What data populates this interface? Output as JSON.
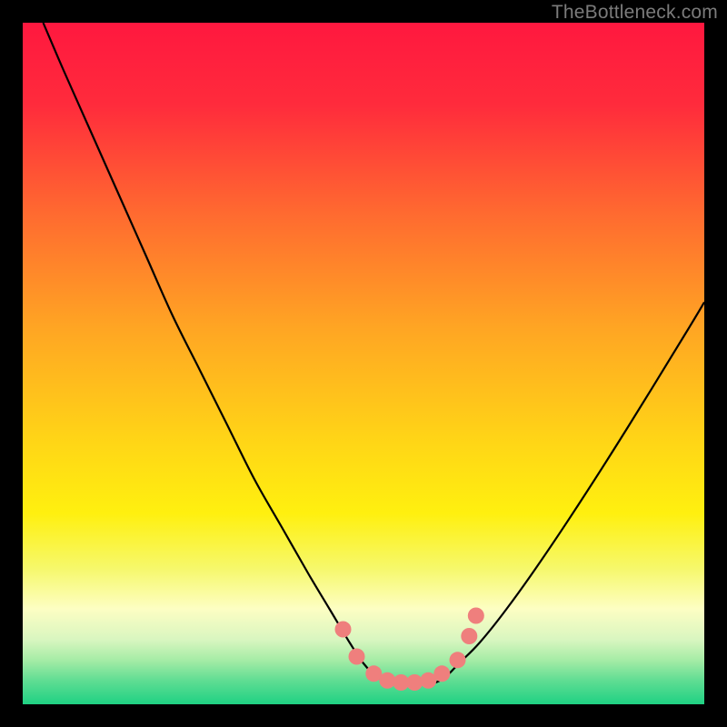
{
  "watermark": "TheBottleneck.com",
  "chart_data": {
    "type": "line",
    "title": "",
    "xlabel": "",
    "ylabel": "",
    "xlim": [
      0,
      100
    ],
    "ylim": [
      0,
      100
    ],
    "background_gradient": {
      "stops": [
        {
          "pos": 0.0,
          "color": "#ff183f"
        },
        {
          "pos": 0.12,
          "color": "#ff2b3c"
        },
        {
          "pos": 0.28,
          "color": "#ff6a30"
        },
        {
          "pos": 0.45,
          "color": "#ffa623"
        },
        {
          "pos": 0.62,
          "color": "#ffd716"
        },
        {
          "pos": 0.72,
          "color": "#fff00f"
        },
        {
          "pos": 0.8,
          "color": "#f6f86a"
        },
        {
          "pos": 0.86,
          "color": "#fdfec3"
        },
        {
          "pos": 0.905,
          "color": "#d9f6c0"
        },
        {
          "pos": 0.935,
          "color": "#a6eca6"
        },
        {
          "pos": 0.965,
          "color": "#60dd93"
        },
        {
          "pos": 1.0,
          "color": "#1fd183"
        }
      ]
    },
    "series": [
      {
        "name": "bottleneck-curve",
        "color": "#000000",
        "x": [
          3,
          6,
          10,
          14,
          18,
          22,
          26,
          30,
          34,
          38,
          42,
          45,
          48,
          50,
          52,
          54,
          56,
          58,
          60,
          62,
          64,
          67,
          71,
          76,
          82,
          89,
          97,
          100
        ],
        "y": [
          100,
          93,
          84,
          75,
          66,
          57,
          49,
          41,
          33,
          26,
          19,
          14,
          9,
          6,
          4,
          3,
          3,
          3,
          3,
          4,
          6,
          9,
          14,
          21,
          30,
          41,
          54,
          59
        ]
      }
    ],
    "markers": {
      "name": "highlight-dots",
      "color": "#ef7f7d",
      "radius_px": 9,
      "points": [
        {
          "x": 47,
          "y": 11
        },
        {
          "x": 49,
          "y": 7
        },
        {
          "x": 51.5,
          "y": 4.5
        },
        {
          "x": 53.5,
          "y": 3.5
        },
        {
          "x": 55.5,
          "y": 3.2
        },
        {
          "x": 57.5,
          "y": 3.2
        },
        {
          "x": 59.5,
          "y": 3.5
        },
        {
          "x": 61.5,
          "y": 4.5
        },
        {
          "x": 63.8,
          "y": 6.5
        },
        {
          "x": 65.5,
          "y": 10
        },
        {
          "x": 66.5,
          "y": 13
        }
      ]
    }
  }
}
